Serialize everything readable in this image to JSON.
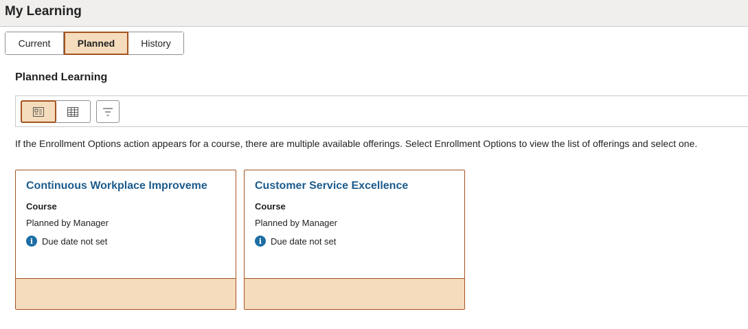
{
  "header": {
    "title": "My Learning"
  },
  "tabs": [
    {
      "label": "Current"
    },
    {
      "label": "Planned"
    },
    {
      "label": "History"
    }
  ],
  "section": {
    "title": "Planned Learning"
  },
  "toolbar": {
    "card_view_icon": "card-view-icon",
    "grid_view_icon": "grid-view-icon",
    "filter_icon": "filter-icon"
  },
  "info_text": "If the Enrollment Options action appears for a course, there are multiple available offerings. Select Enrollment Options to view the list of offerings and select one.",
  "cards": [
    {
      "title": "Continuous Workplace Improveme",
      "type": "Course",
      "planned_by": "Planned by Manager",
      "due": "Due date not set"
    },
    {
      "title": "Customer Service Excellence",
      "type": "Course",
      "planned_by": "Planned by Manager",
      "due": "Due date not set"
    }
  ],
  "colors": {
    "accent": "#a3521f",
    "selected_bg": "#f5dcbc",
    "link": "#1c5b8c",
    "info_icon": "#1c6ea4"
  }
}
